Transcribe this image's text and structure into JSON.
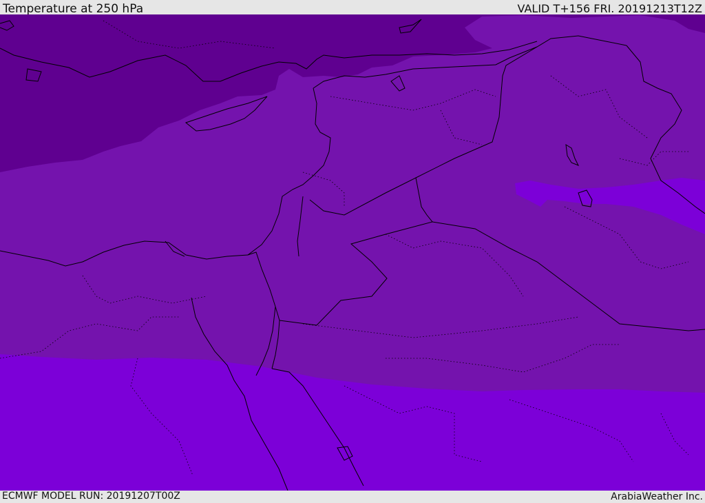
{
  "header": {
    "title": "Temperature at 250 hPa",
    "valid": "VALID T+156 FRI. 20191213T12Z"
  },
  "footer": {
    "model_run": "ECMWF MODEL RUN: 20191207T00Z",
    "provider": "ArabiaWeather Inc."
  },
  "map": {
    "field": "temperature-250hpa",
    "colors": {
      "coldest_band": "#5f0090",
      "middle_band": "#7413ad",
      "warmest_band": "#7c00d8",
      "border_line": "#000000"
    }
  }
}
